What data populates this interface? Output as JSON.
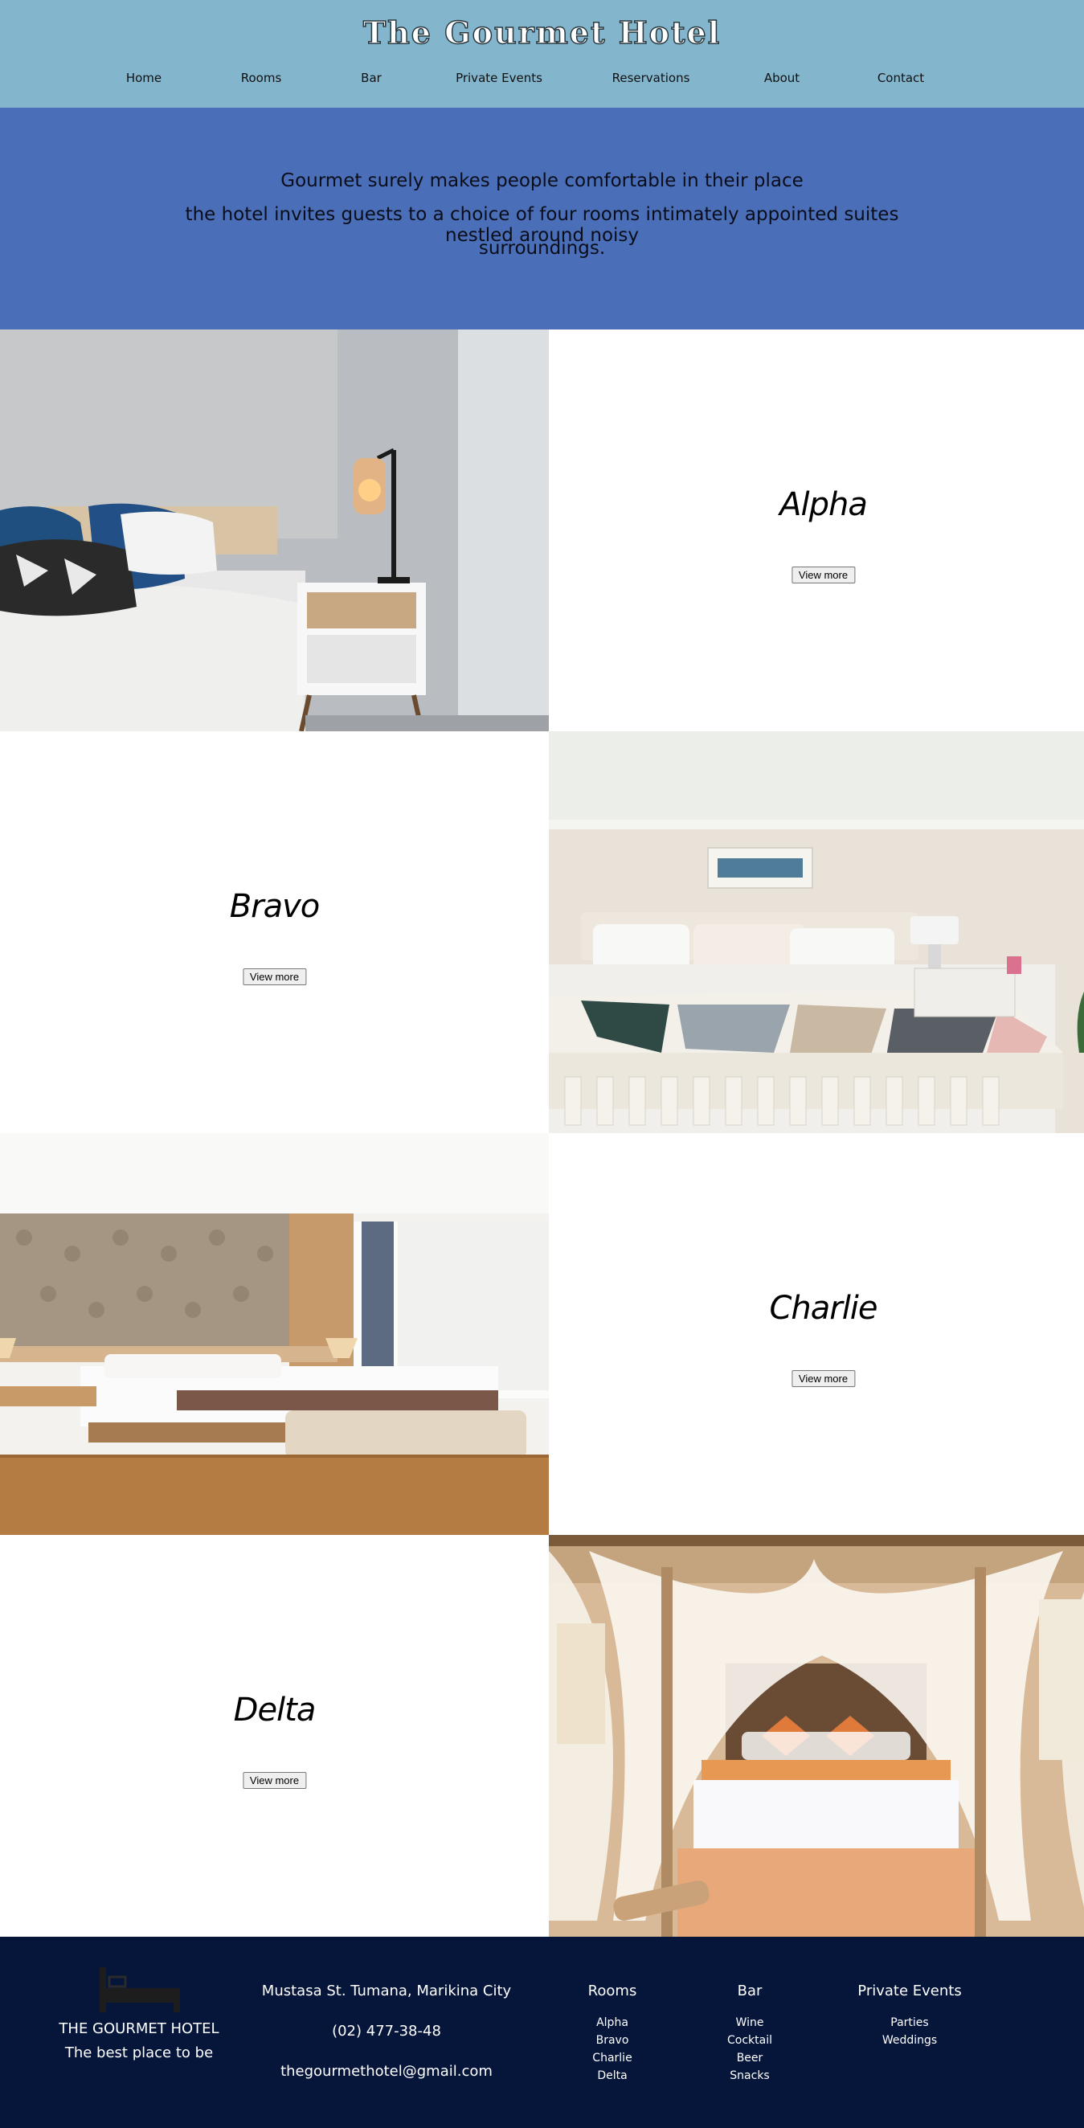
{
  "header": {
    "title": "The Gourmet Hotel",
    "nav": [
      "Home",
      "Rooms",
      "Bar",
      "Private Events",
      "Reservations",
      "About",
      "Contact"
    ]
  },
  "hero": {
    "line1": "Gourmet surely makes people comfortable in their place",
    "line2": "the hotel invites guests to a choice of four rooms intimately appointed suites nestled around noisy",
    "line3": "surroundings."
  },
  "rooms": [
    {
      "name": "Alpha",
      "button": "View more"
    },
    {
      "name": "Bravo",
      "button": "View more"
    },
    {
      "name": "Charlie",
      "button": "View more"
    },
    {
      "name": "Delta",
      "button": "View more"
    }
  ],
  "footer": {
    "brand": "THE GOURMET HOTEL",
    "tagline": "The best place to be",
    "address": "Mustasa St. Tumana, Marikina City",
    "phone": "(02) 477-38-48",
    "email": "thegourmethotel@gmail.com",
    "columns": [
      {
        "heading": "Rooms",
        "items": [
          "Alpha",
          "Bravo",
          "Charlie",
          "Delta"
        ]
      },
      {
        "heading": "Bar",
        "items": [
          "Wine",
          "Cocktail",
          "Beer",
          "Snacks"
        ]
      },
      {
        "heading": "Private Events",
        "items": [
          "Parties",
          "Weddings"
        ]
      }
    ]
  },
  "colors": {
    "header": "#83b5cd",
    "hero": "#4a6fb8",
    "footer": "#06163a"
  }
}
